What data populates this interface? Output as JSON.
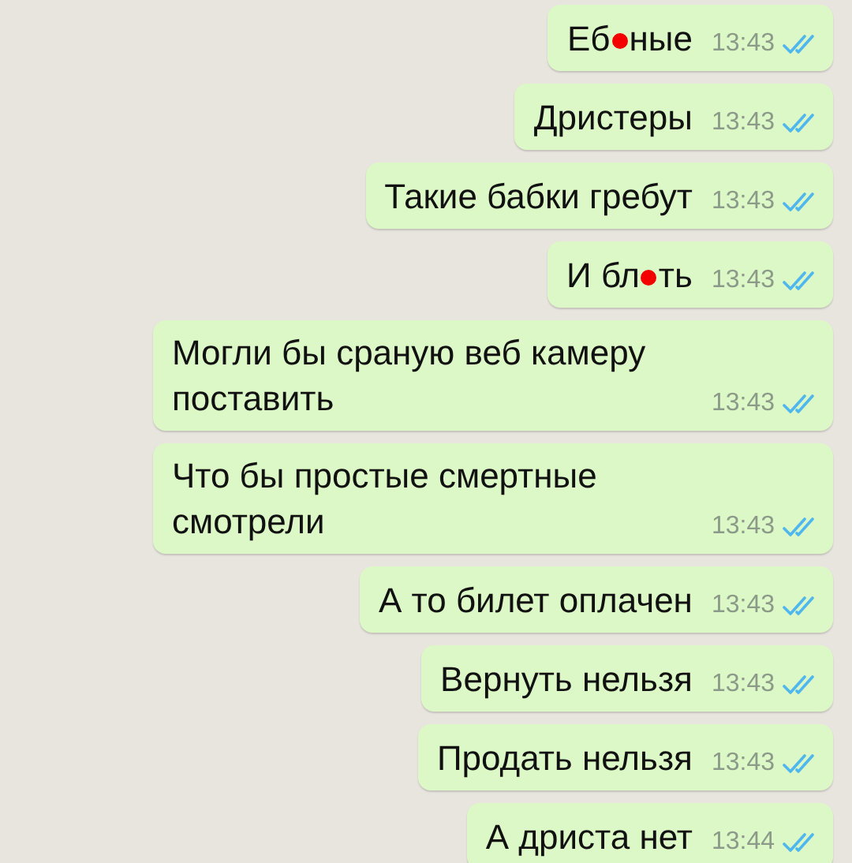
{
  "messages": [
    {
      "parts": [
        {
          "text": "Еб"
        },
        {
          "censored": true
        },
        {
          "text": "ные"
        }
      ],
      "time": "13:43",
      "read": true
    },
    {
      "parts": [
        {
          "text": "Дристеры"
        }
      ],
      "time": "13:43",
      "read": true
    },
    {
      "parts": [
        {
          "text": "Такие бабки гребут"
        }
      ],
      "time": "13:43",
      "read": true
    },
    {
      "parts": [
        {
          "text": "И бл"
        },
        {
          "censored": true
        },
        {
          "text": "ть"
        }
      ],
      "time": "13:43",
      "read": true
    },
    {
      "parts": [
        {
          "text": "Могли бы сраную веб камеру поставить"
        }
      ],
      "time": "13:43",
      "read": true
    },
    {
      "parts": [
        {
          "text": "Что бы простые смертные смотрели"
        }
      ],
      "time": "13:43",
      "read": true
    },
    {
      "parts": [
        {
          "text": "А то билет оплачен"
        }
      ],
      "time": "13:43",
      "read": true
    },
    {
      "parts": [
        {
          "text": "Вернуть нельзя"
        }
      ],
      "time": "13:43",
      "read": true
    },
    {
      "parts": [
        {
          "text": "Продать нельзя"
        }
      ],
      "time": "13:43",
      "read": true
    },
    {
      "parts": [
        {
          "text": "А дриста нет"
        }
      ],
      "time": "13:44",
      "read": true
    }
  ]
}
